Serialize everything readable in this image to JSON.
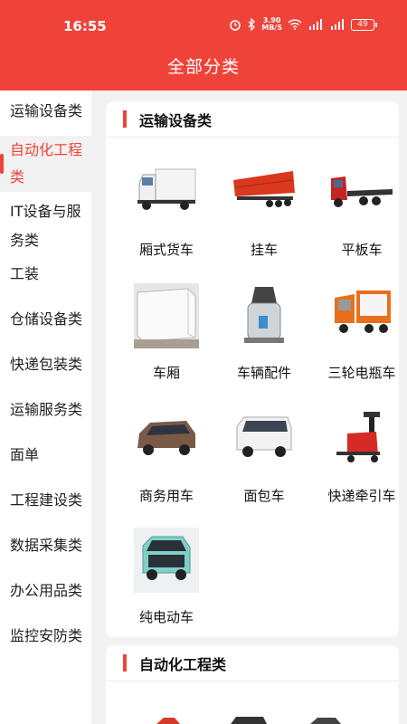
{
  "status": {
    "time": "16:55",
    "speed_value": "3.90",
    "speed_unit": "MB/S",
    "battery": "49"
  },
  "header": {
    "title": "全部分类"
  },
  "sidebar": {
    "items": [
      {
        "label": "运输设备类",
        "active": false
      },
      {
        "label": "自动化工程类",
        "active": true
      },
      {
        "label": "IT设备与服务类",
        "active": false
      },
      {
        "label": "工装",
        "active": false
      },
      {
        "label": "仓储设备类",
        "active": false
      },
      {
        "label": "快递包装类",
        "active": false
      },
      {
        "label": "运输服务类",
        "active": false
      },
      {
        "label": "面单",
        "active": false
      },
      {
        "label": "工程建设类",
        "active": false
      },
      {
        "label": "数据采集类",
        "active": false
      },
      {
        "label": "办公用品类",
        "active": false
      },
      {
        "label": "监控安防类",
        "active": false
      }
    ]
  },
  "sections": [
    {
      "title": "运输设备类",
      "items": [
        {
          "label": "厢式货车",
          "icon": "box-truck-image"
        },
        {
          "label": "挂车",
          "icon": "trailer-image"
        },
        {
          "label": "平板车",
          "icon": "flatbed-truck-image"
        },
        {
          "label": "车厢",
          "icon": "cargo-box-image"
        },
        {
          "label": "车辆配件",
          "icon": "vehicle-part-image"
        },
        {
          "label": "三轮电瓶车",
          "icon": "electric-tricycle-image"
        },
        {
          "label": "商务用车",
          "icon": "mpv-image"
        },
        {
          "label": "面包车",
          "icon": "minivan-image"
        },
        {
          "label": "快递牵引车",
          "icon": "tow-tractor-image"
        },
        {
          "label": "纯电动车",
          "icon": "mini-ev-image"
        }
      ]
    },
    {
      "title": "自动化工程类",
      "items": []
    }
  ],
  "colors": {
    "accent": "#ef4339",
    "background": "#f2f2f2"
  }
}
